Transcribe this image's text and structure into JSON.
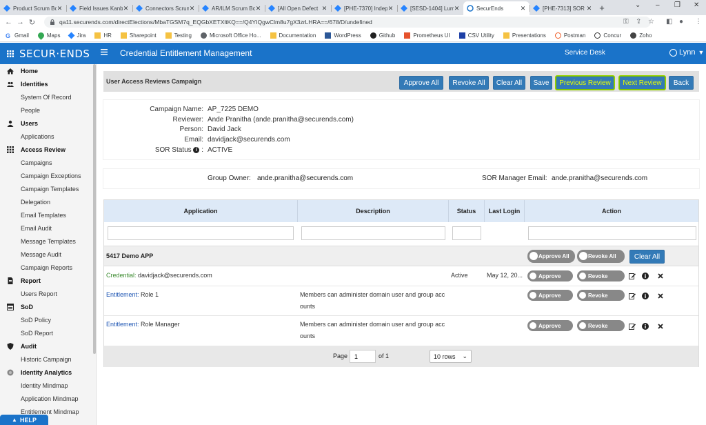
{
  "browser": {
    "tabs": [
      {
        "title": "Product Scrum Bo",
        "active": false
      },
      {
        "title": "Field Issues Kanb",
        "active": false
      },
      {
        "title": "Connectors Scrum",
        "active": false
      },
      {
        "title": "AR/ILM Scrum Bo",
        "active": false
      },
      {
        "title": "[All Open Defect",
        "active": false
      },
      {
        "title": "[PHE-7370] Indep",
        "active": false
      },
      {
        "title": "[SESD-1404] Lum",
        "active": false
      },
      {
        "title": "SecurEnds",
        "active": true
      },
      {
        "title": "[PHE-7313] SOR",
        "active": false
      }
    ],
    "url": "qa11.securends.com/directElections/MbaTGSM7q_EQGbXETXltKQ==/Q4YIQgwClm8u7gX3zrLHRA==/678/D/undefined",
    "bookmarks": [
      "Gmail",
      "Maps",
      "Jira",
      "HR",
      "Sharepoint",
      "Testing",
      "Microsoft Office Ho...",
      "Documentation",
      "WordPress",
      "Github",
      "Prometheus UI",
      "CSV Utility",
      "Presentations",
      "Postman",
      "Concur",
      "Zoho"
    ]
  },
  "app": {
    "logo": "SECUR·ENDS",
    "title": "Credential Entitlement Management",
    "service_desk": "Service Desk",
    "user": "Lynn"
  },
  "sidebar": {
    "items": [
      {
        "label": "Home",
        "type": "section",
        "icon": "home-icon"
      },
      {
        "label": "Identities",
        "type": "section",
        "icon": "users-icon"
      },
      {
        "label": "System Of Record",
        "type": "item"
      },
      {
        "label": "People",
        "type": "item"
      },
      {
        "label": "Users",
        "type": "section",
        "icon": "user-icon"
      },
      {
        "label": "Applications",
        "type": "item"
      },
      {
        "label": "Access Review",
        "type": "section",
        "icon": "grid-icon"
      },
      {
        "label": "Campaigns",
        "type": "item"
      },
      {
        "label": "Campaign Exceptions",
        "type": "item"
      },
      {
        "label": "Campaign Templates",
        "type": "item"
      },
      {
        "label": "Delegation",
        "type": "item"
      },
      {
        "label": "Email Templates",
        "type": "item"
      },
      {
        "label": "Email Audit",
        "type": "item"
      },
      {
        "label": "Message Templates",
        "type": "item"
      },
      {
        "label": "Message Audit",
        "type": "item"
      },
      {
        "label": "Campaign Reports",
        "type": "item"
      },
      {
        "label": "Report",
        "type": "section",
        "icon": "report-icon"
      },
      {
        "label": "Users Report",
        "type": "item"
      },
      {
        "label": "SoD",
        "type": "section",
        "icon": "sod-icon"
      },
      {
        "label": "SoD Policy",
        "type": "item"
      },
      {
        "label": "SoD Report",
        "type": "item"
      },
      {
        "label": "Audit",
        "type": "section",
        "icon": "shield-icon"
      },
      {
        "label": "Historic Campaign",
        "type": "item"
      },
      {
        "label": "Identity Analytics",
        "type": "section",
        "icon": "analytics-icon"
      },
      {
        "label": "Identity Mindmap",
        "type": "item"
      },
      {
        "label": "Application Mindmap",
        "type": "item"
      },
      {
        "label": "Entitlement Mindmap",
        "type": "item"
      }
    ],
    "help": "HELP"
  },
  "campaign": {
    "bar_title": "User Access Reviews Campaign",
    "buttons": {
      "approve_all": "Approve All",
      "revoke_all": "Revoke All",
      "clear_all": "Clear All",
      "save": "Save",
      "previous_review": "Previous Review",
      "next_review": "Next Review",
      "back": "Back"
    },
    "info": {
      "campaign_name_label": "Campaign Name:",
      "campaign_name": "AP_7225 DEMO",
      "reviewer_label": "Reviewer:",
      "reviewer": "Ande Pranitha (ande.pranitha@securends.com)",
      "person_label": "Person:",
      "person": "David Jack",
      "email_label": "Email:",
      "email": "davidjack@securends.com",
      "sor_status_label": "SOR Status",
      "sor_status_colon": ":",
      "sor_status": "ACTIVE"
    },
    "owner": {
      "group_owner_label": "Group Owner:",
      "group_owner": "ande.pranitha@securends.com",
      "sor_manager_label": "SOR Manager Email:",
      "sor_manager": "ande.pranitha@securends.com"
    }
  },
  "table": {
    "columns": [
      "Application",
      "Description",
      "Status",
      "Last Login",
      "Action"
    ],
    "group": {
      "name": "5417 Demo APP",
      "approve_all": "Approve All",
      "revoke_all": "Revoke All",
      "clear_all": "Clear All"
    },
    "rows": [
      {
        "type": "Credential:",
        "name": "davidjack@securends.com",
        "description_1": "",
        "description_2": "",
        "status": "Active",
        "last_login": "May 12, 20...",
        "approve": "Approve",
        "revoke": "Revoke"
      },
      {
        "type": "Entitlement:",
        "name": "Role 1",
        "description_1": "Members can administer domain user and group acc",
        "description_2": "ounts",
        "status": "",
        "last_login": "",
        "approve": "Approve",
        "revoke": "Revoke"
      },
      {
        "type": "Entitlement:",
        "name": "Role Manager",
        "description_1": "Members can administer domain user and group acc",
        "description_2": "ounts",
        "status": "",
        "last_login": "",
        "approve": "Approve",
        "revoke": "Revoke"
      }
    ],
    "pager": {
      "page_label": "Page",
      "page_value": "1",
      "of_label": "of 1",
      "rows_option": "10 rows"
    }
  },
  "colors": {
    "brand_blue": "#1a73c9",
    "button_blue": "#337ab7",
    "credential_green": "#3a8a2e",
    "entitlement_blue": "#1d55b3",
    "highlight_yellow": "#e8ff00"
  }
}
